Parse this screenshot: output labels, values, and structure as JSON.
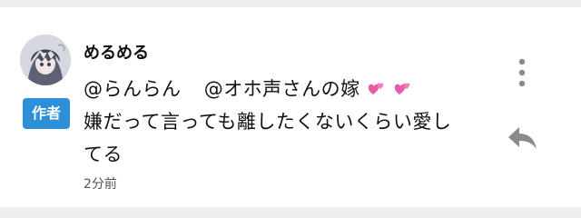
{
  "comment": {
    "username": "めるめる",
    "badge": "作者",
    "mentions": [
      "@らんらん",
      "@オホ声さんの嫁"
    ],
    "text_line_2": "嫌だって言っても離したくないくらい愛し",
    "text_line_3": "てる",
    "timestamp": "2分前"
  },
  "icons": {
    "heart": "two-hearts-icon",
    "more": "vertical-ellipsis-icon",
    "reply": "reply-arrow-icon"
  },
  "colors": {
    "badge_bg": "#2d8fd8",
    "text": "#111111",
    "icon": "#8a8a8a",
    "heart": "#e75aa6"
  }
}
